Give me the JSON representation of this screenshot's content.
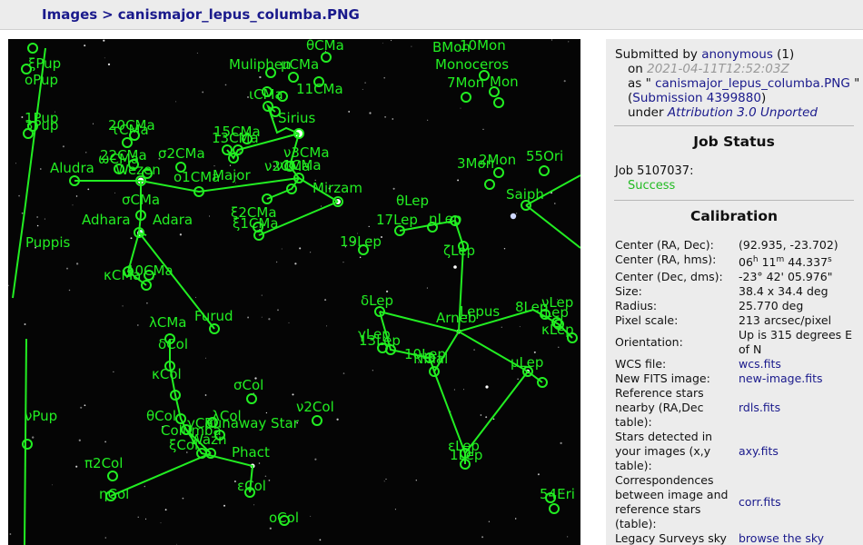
{
  "breadcrumb": {
    "images": "Images",
    "separator": ">",
    "filename": "canismajor_lepus_columba.PNG"
  },
  "submission": {
    "submitted_by_label": "Submitted by",
    "user": "anonymous",
    "user_count": "(1)",
    "on_label": "on",
    "date": "2021-04-11T12:52:03Z",
    "as_label": "as \"",
    "file": "canismajor_lepus_columba.PNG",
    "file_end": "\"",
    "open_paren": "(",
    "submission_link": "Submission 4399880",
    "close_paren": ")",
    "under_label": "under",
    "license": "Attribution 3.0 Unported"
  },
  "job_status": {
    "title": "Job Status",
    "job_label": "Job 5107037:",
    "status": "Success"
  },
  "calibration": {
    "title": "Calibration",
    "center_radec_label": "Center (RA, Dec):",
    "center_radec": "(92.935, -23.702)",
    "center_hms_label": "Center (RA, hms):",
    "hms_h": "06",
    "hms_m": "11",
    "hms_s": "44.337",
    "center_dms_label": "Center (Dec, dms):",
    "center_dms": "-23° 42' 05.976\"",
    "size_label": "Size:",
    "size": "38.4 x 34.4 deg",
    "radius_label": "Radius:",
    "radius": "25.770 deg",
    "pixel_scale_label": "Pixel scale:",
    "pixel_scale": "213 arcsec/pixel",
    "orientation_label": "Orientation:",
    "orientation": "Up is 315 degrees E of N",
    "wcs_label": "WCS file:",
    "wcs": "wcs.fits",
    "newfits_label": "New FITS image:",
    "newfits": "new-image.fits",
    "ref_label": "Reference stars nearby (RA,Dec table):",
    "ref": "rdls.fits",
    "detected_label": "Stars detected in your images (x,y table):",
    "detected": "axy.fits",
    "corr_label": "Correspondences between image and reference stars (table):",
    "corr": "corr.fits",
    "legacy_label": "Legacy Surveys sky",
    "legacy": "browse the sky"
  },
  "sky": {
    "colors": {
      "background": "#050505",
      "annotation": "#22ee22"
    },
    "labels": {
      "theta_cma": "θCMa",
      "mon10": "10Mon",
      "bmon": "BMon",
      "monoceros": "Monoceros",
      "xi_pup": "ξPup",
      "o_pup": "oPup",
      "muliphen": "Muliphen",
      "omicron_cma": "μCMa",
      "mon7": "7Mon",
      "zeta_mon": "Mon",
      "cma11": "11CMa",
      "iota_cma": "ιCMa",
      "pup1": "1Pup",
      "pup2": "3Pup",
      "sirius": "Sirius",
      "cma20": "20CMa",
      "tau_cma": "τCMa",
      "cma15": "15CMa",
      "cma13": "13CMa",
      "nu3_cma": "ν3CMa",
      "nu1_cma": "ν1CMa",
      "cma22": "22CMa",
      "omega_cma": "ωCMa",
      "wezen": "Wezen",
      "sigma_cma": "σ2CMa",
      "o1_cma": "o1CMa",
      "major": "Major",
      "nu2_cma": "ν2CMa",
      "aludra": "Aludra",
      "sigma2_cma": "σCMa",
      "mirzam": "Mirzam",
      "xi2_cma": "ξ2CMa",
      "xi1_cma": "ξ1CMa",
      "theta_lep": "θLep",
      "lep17": "17Lep",
      "eta_lep": "ηLep",
      "lep19": "19Lep",
      "zeta_lep": "ζLep",
      "adhara": "Adhara",
      "adhara2": "Adara",
      "puppis": "Puppis",
      "kappa_cma": "κCMa",
      "cma10": "10CMa",
      "furud": "Furud",
      "mon3": "3Mon",
      "mon2": "2Mon",
      "ori55": "55Ori",
      "saiph": "Saiph",
      "delta_lep": "δLep",
      "lepus": "Lepus",
      "arneb": "Arneb",
      "lep8": "8Lep",
      "nu_lep": "νLep",
      "iota_lep": "ιLep",
      "kappa_lep": "κLep",
      "lambda_cma": "λCMa",
      "delta_col": "δCol",
      "kappa_col": "κCol",
      "gamma_lep": "γLep",
      "lep13": "13Lep",
      "lep10": "10Lep",
      "nihal": "Nihal",
      "mu_lep": "μLep",
      "sigma_col": "σCol",
      "nu2_col": "ν2Col",
      "theta_col": "θCol",
      "lambda_col": "λCol",
      "gamma_col": "γCol",
      "columba": "Columba",
      "wazn": "Wazn",
      "runaway": "Runaway Star",
      "xi_col": "ξCol",
      "phact": "Phact",
      "nu_pup": "νPup",
      "pi2_col": "π2Col",
      "eta_col": "ηCol",
      "epsilon_col": "εCol",
      "epsilon_lep": "εLep",
      "lep1": "1Lep",
      "omicron_col": "oCol",
      "eri54": "54Eri"
    }
  }
}
